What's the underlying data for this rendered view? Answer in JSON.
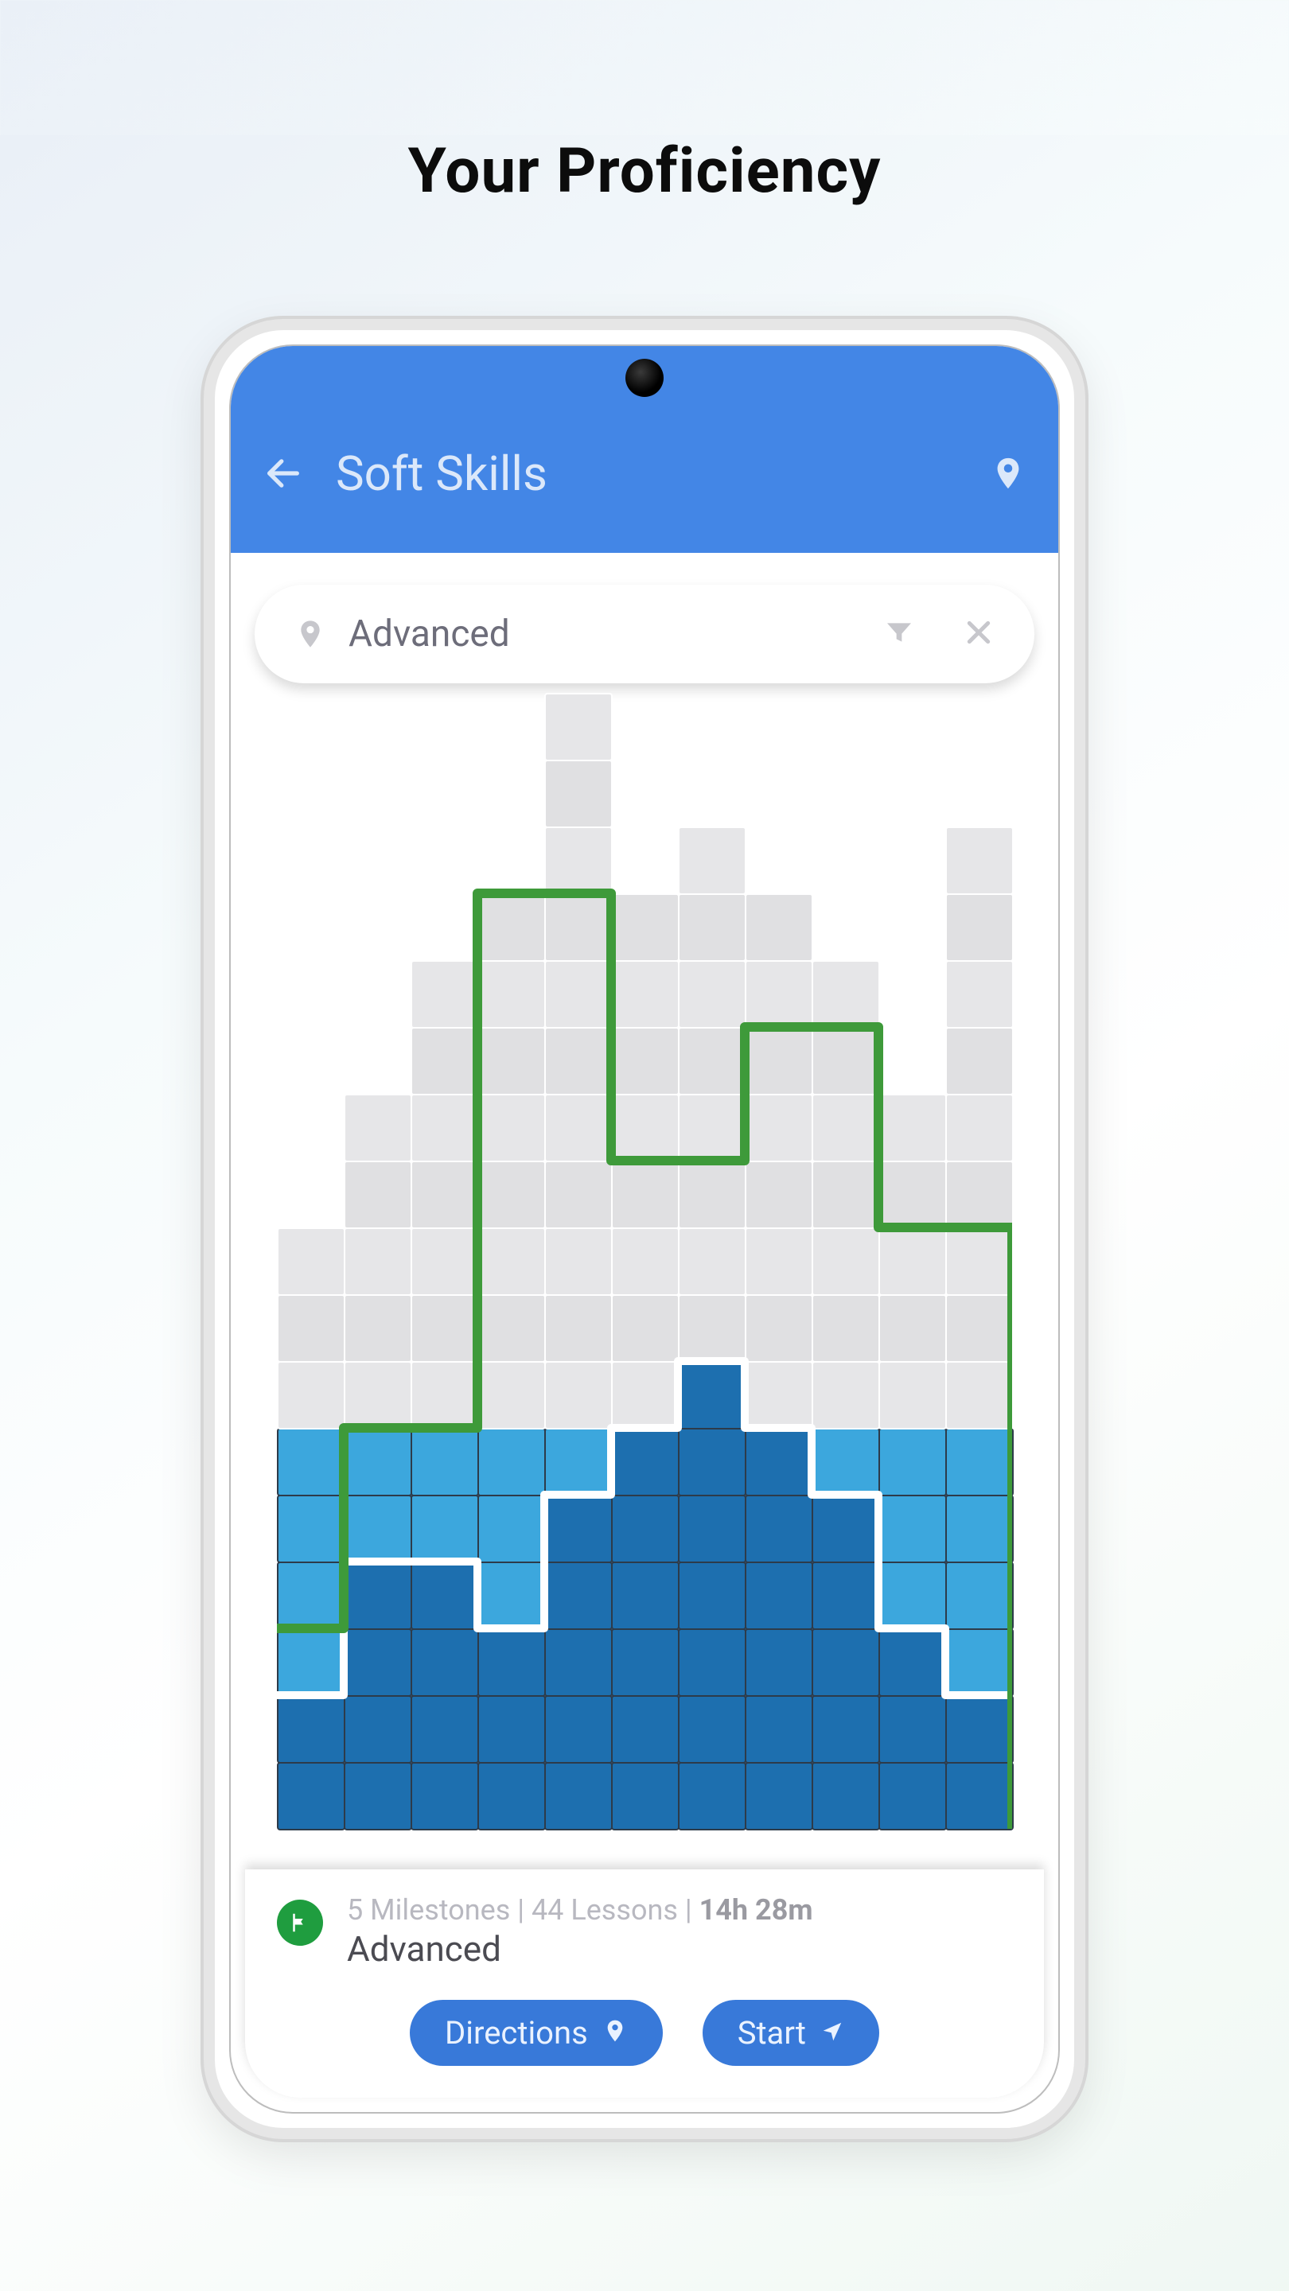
{
  "page": {
    "title": "Your Proficiency"
  },
  "header": {
    "title": "Soft Skills"
  },
  "search": {
    "value": "Advanced"
  },
  "summary": {
    "milestones_label": "5 Milestones",
    "lessons_label": "44 Lessons",
    "duration_label": "14h 28m",
    "separator": " | ",
    "level": "Advanced"
  },
  "actions": {
    "directions": "Directions",
    "start": "Start"
  },
  "colors": {
    "header_bg": "#4386e6",
    "button_bg": "#3879d9",
    "flag_bg": "#1f9d3f",
    "chart_gray": "#e6e6e8",
    "chart_light": "#3ca7dd",
    "chart_dark": "#1d6faf",
    "green_path": "#3e9a3a"
  },
  "chart_data": {
    "type": "bar",
    "title": "",
    "xlabel": "",
    "ylabel": "",
    "ylim": [
      0,
      18
    ],
    "columns": 11,
    "categories": [
      "c0",
      "c1",
      "c2",
      "c3",
      "c4",
      "c5",
      "c6",
      "c7",
      "c8",
      "c9",
      "c10"
    ],
    "series": [
      {
        "name": "total_cells",
        "values": [
          9,
          11,
          13,
          14,
          17,
          14,
          15,
          14,
          13,
          11,
          15
        ]
      },
      {
        "name": "target_green",
        "values": [
          3,
          6,
          6,
          14,
          14,
          10,
          10,
          12,
          12,
          9,
          9
        ]
      },
      {
        "name": "your_light",
        "values": [
          6,
          6,
          6,
          6,
          6,
          6,
          6,
          6,
          6,
          6,
          6
        ]
      },
      {
        "name": "your_dark",
        "values": [
          2,
          4,
          4,
          3,
          5,
          6,
          7,
          6,
          5,
          3,
          2
        ]
      }
    ]
  }
}
